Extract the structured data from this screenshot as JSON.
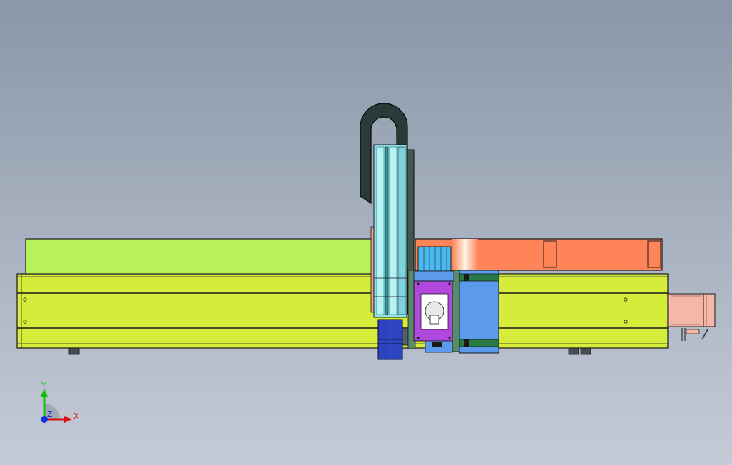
{
  "viewport": {
    "background_top": "#8a97a8",
    "background_bottom": "#c4cbd6"
  },
  "model": {
    "colors": {
      "base_frame": "#d6ec3a",
      "upper_rail": "#b8f25a",
      "cable_carrier": "#2a3a36",
      "z_axis_column": "#8fe3ea",
      "coupling_block": "#e8a08a",
      "bracket_green": "#5a8a6a",
      "beam_orange": "#ff8458",
      "carriage_blue": "#5c9aec",
      "motor_plate_purple": "#b048e0",
      "motor_blue": "#2c44c0",
      "servo_motor": "#f5b8a8",
      "leveling_feet": "#4a4a52"
    }
  },
  "triad": {
    "x_label": "X",
    "y_label": "Y",
    "z_label": "Z",
    "x_color": "#e01010",
    "y_color": "#10c010",
    "z_color": "#1030e0"
  }
}
